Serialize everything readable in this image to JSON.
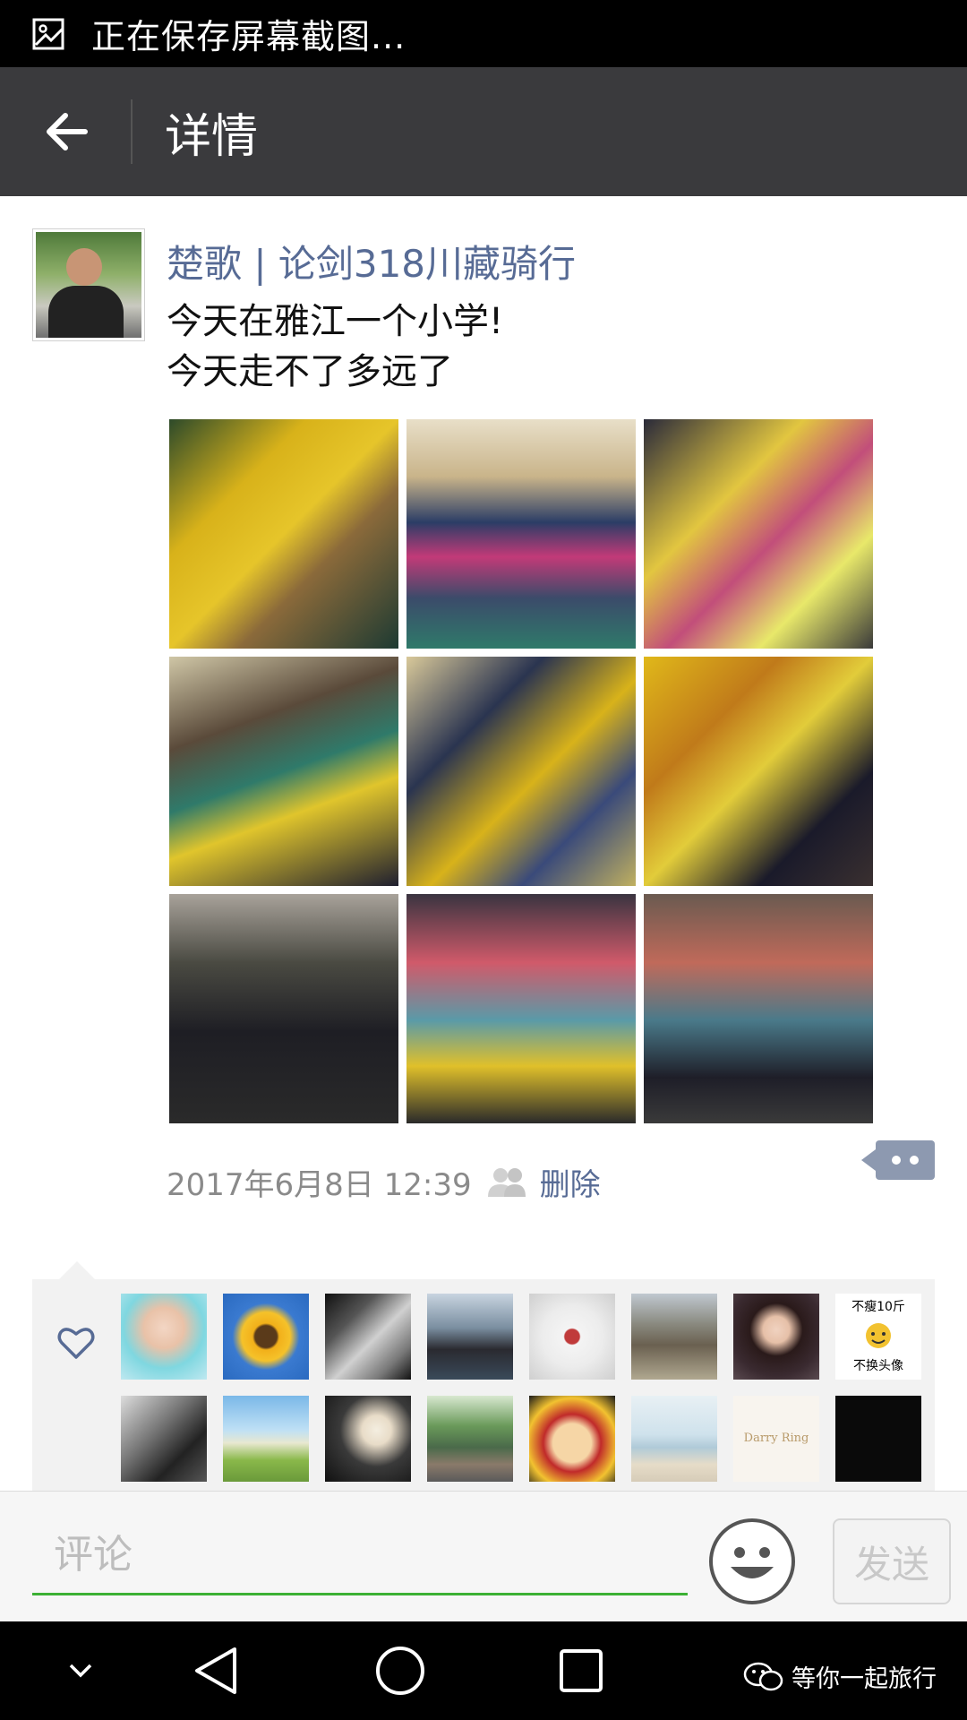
{
  "status_bar": {
    "text": "正在保存屏幕截图..."
  },
  "nav": {
    "title": "详情"
  },
  "post": {
    "username": "楚歌 | 论剑318川藏骑行",
    "text": "今天在雅江一个小学!\n今天走不了多远了",
    "timestamp": "2017年6月8日 12:39",
    "delete_label": "删除",
    "photo_count": 9
  },
  "likes": {
    "avatar_labels": {
      "a8_top": "不瘦10斤",
      "a8_bottom": "不换头像",
      "a15": "Darry Ring"
    }
  },
  "comment_bar": {
    "placeholder": "评论",
    "send_label": "发送"
  },
  "watermark": {
    "text": "等你一起旅行"
  },
  "colors": {
    "link": "#576b95",
    "nav_bg": "#3a3a3d",
    "input_underline": "#3cb034"
  }
}
